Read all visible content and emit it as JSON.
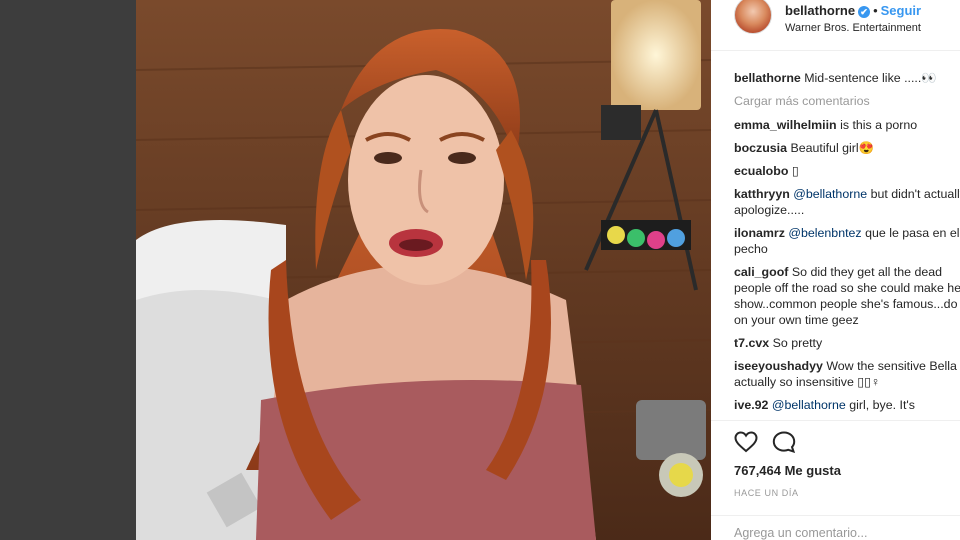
{
  "post": {
    "photo_alt": "",
    "header": {
      "username": "bellathorne",
      "verified_icon": "verified-badge-icon",
      "separator": "•",
      "follow_label": "Seguir",
      "location": "Warner Bros. Entertainment"
    },
    "caption": {
      "user": "bellathorne",
      "text": "Mid-sentence like .....👀"
    },
    "load_more_label": "Cargar más comentarios",
    "comments": [
      {
        "user": "emma_wilhelmiin",
        "mention": "",
        "text": "is this a porno"
      },
      {
        "user": "boczusia",
        "mention": "",
        "text": "Beautiful girl😍"
      },
      {
        "user": "ecualobo",
        "mention": "",
        "text": "▯"
      },
      {
        "user": "katthryyn",
        "mention": "@bellathorne",
        "text": "but didn't actually apologize....."
      },
      {
        "user": "ilonamrz",
        "mention": "@belenbntez",
        "text": "que le pasa en el pecho"
      },
      {
        "user": "cali_goof",
        "mention": "",
        "text": "So did they get all the dead people off the road so she could make her show..common people she's famous...do it on your own time geez"
      },
      {
        "user": "t7.cvx",
        "mention": "",
        "text": "So pretty"
      },
      {
        "user": "iseeyoushadyy",
        "mention": "",
        "text": "Wow the sensitive Bella is actually so insensitive ▯▯♀"
      },
      {
        "user": "ive.92",
        "mention": "@bellathorne",
        "text": "girl, bye. It's"
      }
    ],
    "actions": {
      "like_icon": "heart-icon",
      "comment_icon": "comment-icon",
      "likes": "767,464 Me gusta",
      "time": "HACE UN DÍA",
      "add_comment_placeholder": "Agrega un comentario..."
    }
  }
}
